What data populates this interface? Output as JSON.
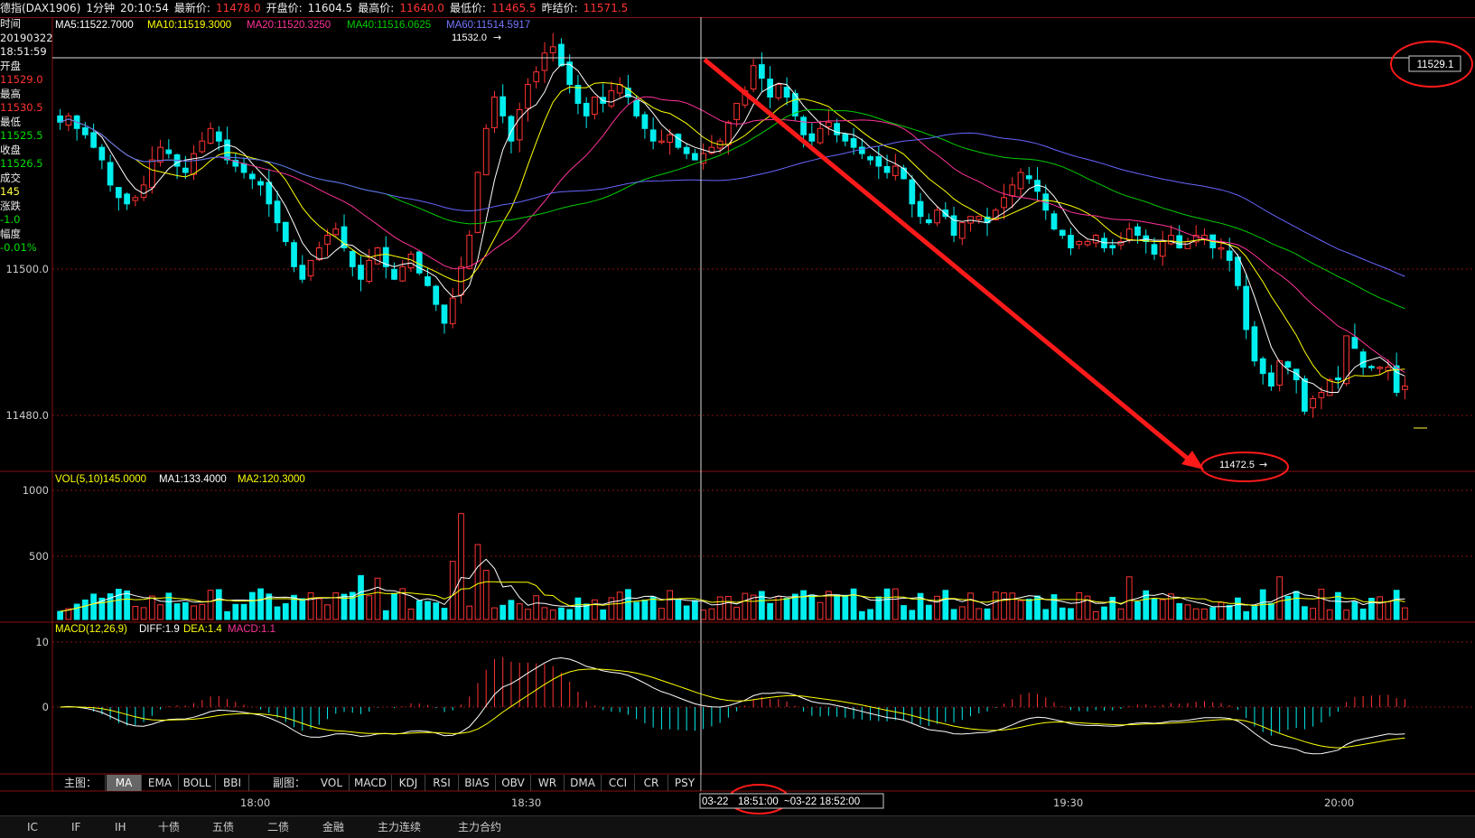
{
  "header": {
    "symbol": "德指(DAX1906)",
    "period": "1分钟",
    "time": "20:10:54",
    "last_label": "最新价:",
    "last_value": "11478.0",
    "open_label": "开盘价:",
    "open_value": "11604.5",
    "high_label": "最高价:",
    "high_value": "11640.0",
    "low_label": "最低价:",
    "low_value": "11465.5",
    "prev_label": "昨结价:",
    "prev_value": "11571.5"
  },
  "info_panel": {
    "time_label": "时间",
    "date": "20190322",
    "clock": "18:51:59",
    "open_label": "开盘",
    "open": "11529.0",
    "high_label": "最高",
    "high": "11530.5",
    "low_label": "最低",
    "low": "11525.5",
    "close_label": "收盘",
    "close": "11526.5",
    "vol_label": "成交",
    "vol": "145",
    "chg_label": "涨跌",
    "chg": "-1.0",
    "pct_label": "幅度",
    "pct": "-0.01%"
  },
  "ma_legend": {
    "ma5": "MA5:11522.7000",
    "ma10": "MA10:11519.3000",
    "ma20": "MA20:11520.3250",
    "ma40": "MA40:11516.0625",
    "ma60": "MA60:11514.5917"
  },
  "vol_legend": {
    "vol": "VOL(5,10)145.0000",
    "ma1": "MA1:133.4000",
    "ma2": "MA2:120.3000"
  },
  "macd_legend": {
    "macd": "MACD(12,26,9)",
    "diff": "DIFF:1.9",
    "dea": "DEA:1.4",
    "val": "MACD:1.1"
  },
  "price_axis": {
    "p11500": "11500.0",
    "p11480": "11480.0"
  },
  "vol_axis": {
    "v1000": "1000",
    "v500": "500"
  },
  "macd_axis": {
    "m10": "10",
    "m0": "0"
  },
  "annotations": {
    "high_mark": "11532.0",
    "crosshair_price": "11529.1",
    "low_mark": "11472.5"
  },
  "time_axis": {
    "t1": "18:00",
    "t2": "18:30",
    "t3": "19:30",
    "t4": "20:00",
    "crosshair_range_start": "03-22",
    "crosshair_range_time": "18:51:00",
    "crosshair_range_end": "~03-22 18:52:00"
  },
  "toolbar": {
    "main_label": "主图：",
    "main_tabs": [
      "MA",
      "EMA",
      "BOLL",
      "BBI"
    ],
    "sub_label": "副图：",
    "sub_tabs": [
      "VOL",
      "MACD",
      "KDJ",
      "RSI",
      "BIAS",
      "OBV",
      "WR",
      "DMA",
      "CCI",
      "CR",
      "PSY"
    ]
  },
  "bottom_tabs": [
    "IC",
    "IF",
    "IH",
    "十债",
    "五债",
    "二债",
    "金融",
    "主力连续",
    "主力合约"
  ],
  "colors": {
    "up": "#ff3333",
    "down": "#00eeee",
    "ma5": "#ffffff",
    "ma10": "#ffff00",
    "ma20": "#ff3399",
    "ma40": "#00cc00",
    "ma60": "#6666ff",
    "grid": "#8a1111"
  },
  "chart_data": {
    "type": "candlestick",
    "price_ylim": [
      11465,
      11536
    ],
    "vol_ylim": [
      0,
      1000
    ],
    "macd_ylim": [
      -10,
      10
    ],
    "close": [
      11520,
      11521,
      11519,
      11518,
      11516,
      11514,
      11510,
      11508,
      11507,
      11508,
      11510,
      11514,
      11516,
      11515,
      11513,
      11512,
      11515,
      11517,
      11519,
      11517,
      11514,
      11513,
      11512,
      11511,
      11510,
      11507,
      11504,
      11501,
      11497,
      11495,
      11498,
      11500,
      11502,
      11503,
      11500,
      11497,
      11495,
      11498,
      11500,
      11497,
      11495,
      11497,
      11499,
      11496,
      11494,
      11491,
      11488,
      11492,
      11497,
      11502,
      11512,
      11519,
      11524,
      11521,
      11517,
      11522,
      11526,
      11528,
      11531,
      11532,
      11529,
      11526,
      11523,
      11521,
      11524,
      11523,
      11525,
      11526,
      11524,
      11521,
      11519,
      11517,
      11517,
      11518,
      11516,
      11515,
      11514,
      11515,
      11516,
      11517,
      11520,
      11523,
      11525,
      11529,
      11527,
      11524,
      11526,
      11524,
      11521,
      11518,
      11517,
      11519,
      11520,
      11518,
      11517,
      11516,
      11515,
      11514,
      11513,
      11512,
      11513,
      11511,
      11507,
      11505,
      11504,
      11506,
      11505,
      11502,
      11504,
      11505,
      11505,
      11504,
      11506,
      11508,
      11510,
      11512,
      11511,
      11509,
      11506,
      11503,
      11502,
      11500,
      11501,
      11501,
      11502,
      11500,
      11500,
      11501,
      11503,
      11502,
      11501,
      11499,
      11501,
      11502,
      11500,
      11501,
      11502,
      11502,
      11500,
      11500,
      11498,
      11494,
      11487,
      11482,
      11480,
      11478,
      11482,
      11481,
      11479,
      11474,
      11476,
      11477,
      11479,
      11479,
      11486,
      11484,
      11481,
      11481,
      11481,
      11481,
      11477,
      11478
    ]
  }
}
